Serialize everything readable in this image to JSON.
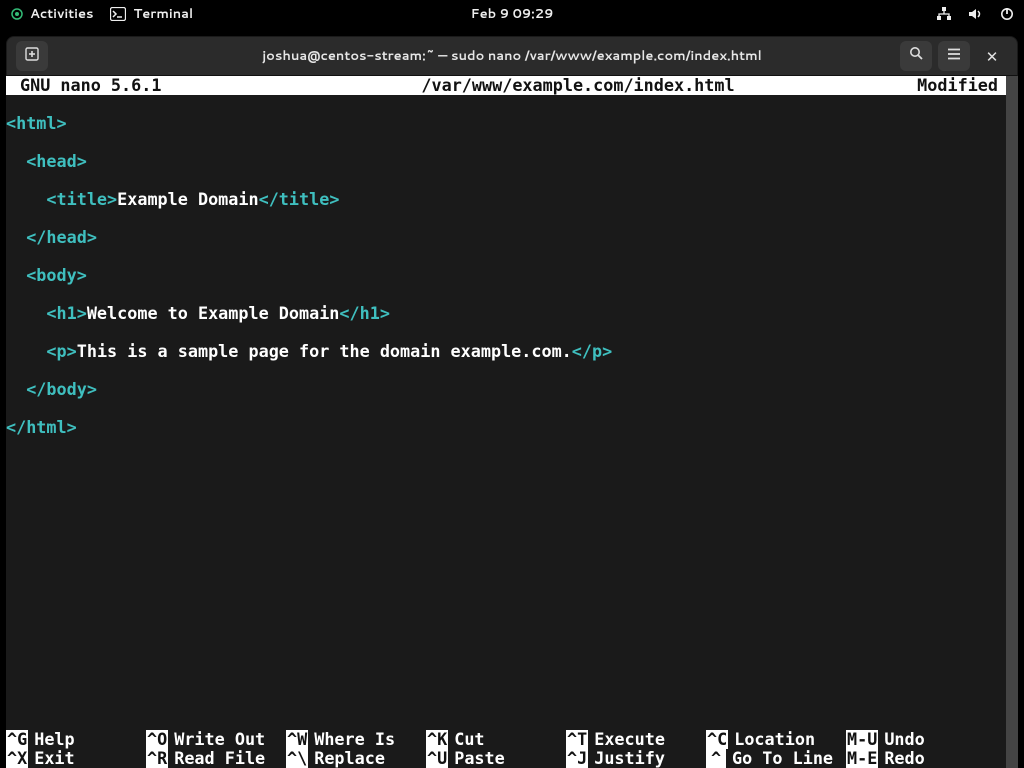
{
  "topbar": {
    "activities": "Activities",
    "app": "Terminal",
    "clock": "Feb 9  09:29"
  },
  "window": {
    "title": "joshua@centos-stream:~ — sudo nano /var/www/example.com/index.html"
  },
  "nano": {
    "version": "GNU nano 5.6.1",
    "filepath": "/var/www/example.com/index.html",
    "status": "Modified"
  },
  "content": {
    "l1a": "<html>",
    "l2a": "  <head>",
    "l3a": "    <title>",
    "l3b": "Example Domain",
    "l3c": "</title>",
    "l4a": "  </head>",
    "l5a": "  <body>",
    "l6a": "    <h1>",
    "l6b": "Welcome to Example Domain",
    "l6c": "</h1>",
    "l7a": "    <p>",
    "l7b": "This is a sample page for the domain example.com.",
    "l7c": "</p>",
    "l8a": "  </body>",
    "l9a": "</html>"
  },
  "shortcuts": {
    "row1": [
      {
        "k": "^G",
        "l": "Help"
      },
      {
        "k": "^O",
        "l": "Write Out"
      },
      {
        "k": "^W",
        "l": "Where Is"
      },
      {
        "k": "^K",
        "l": "Cut"
      },
      {
        "k": "^T",
        "l": "Execute"
      },
      {
        "k": "^C",
        "l": "Location"
      },
      {
        "k": "M-U",
        "l": "Undo"
      }
    ],
    "row2": [
      {
        "k": "^X",
        "l": "Exit"
      },
      {
        "k": "^R",
        "l": "Read File"
      },
      {
        "k": "^\\",
        "l": "Replace"
      },
      {
        "k": "^U",
        "l": "Paste"
      },
      {
        "k": "^J",
        "l": "Justify"
      },
      {
        "k": "^ ",
        "l": "Go To Line"
      },
      {
        "k": "M-E",
        "l": "Redo"
      }
    ]
  }
}
